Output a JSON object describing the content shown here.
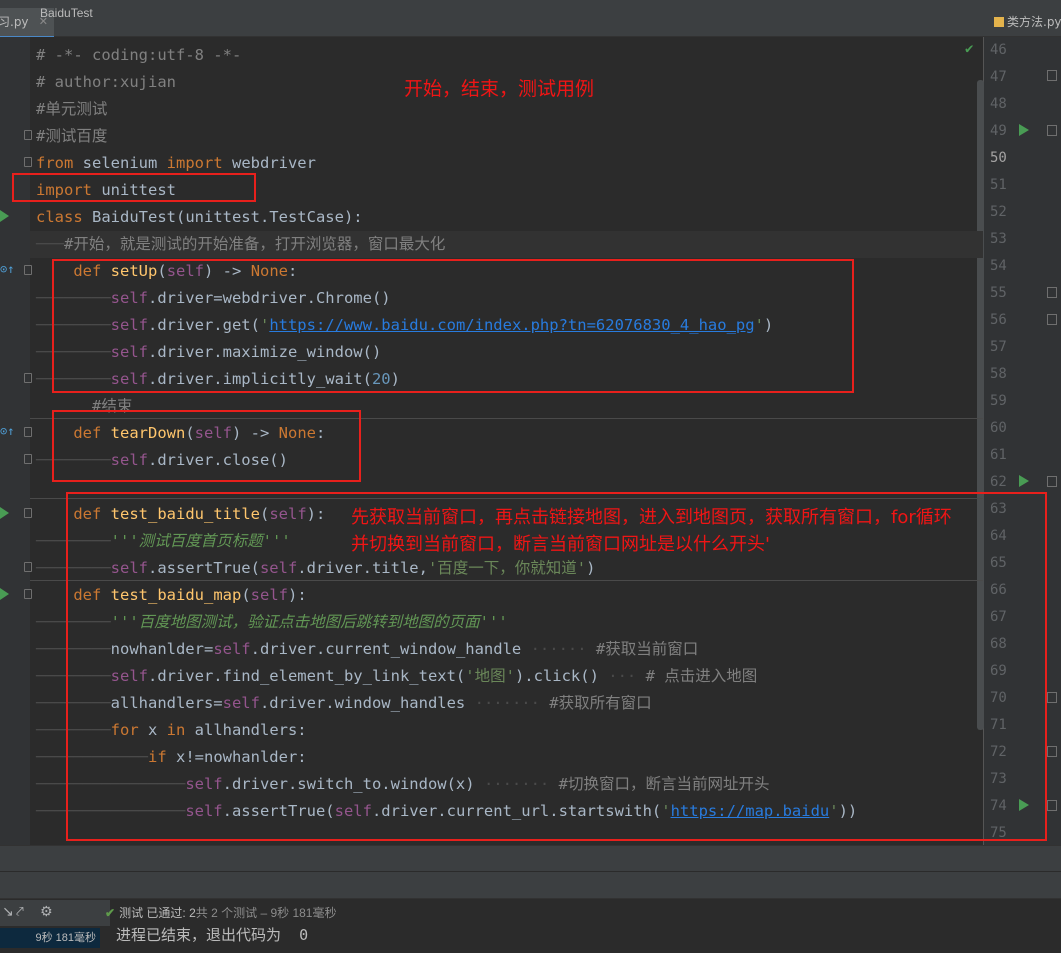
{
  "tabs": {
    "left": "练习.py",
    "right": "类方法.py"
  },
  "editor": {
    "lines": {
      "coding": "# -*- coding:utf-8 -*-",
      "author": "# author:xujian",
      "c_unit": "#单元测试",
      "c_baidu": "#测试百度",
      "from": "from",
      "selenium": " selenium ",
      "import_kw": "import",
      "webdriver": " webdriver",
      "import2_kw": "import",
      "unittest": " unittest",
      "class_kw": "class",
      "class_rest": " BaiduTest(unittest.TestCase):",
      "c_start": "#开始，就是测试的开始准备，打开浏览器，窗口最大化",
      "def": "def",
      "setup": "setUp",
      "self": "self",
      "arrow_none": ") -> ",
      "none": "None",
      "colon": ":",
      "open_paren": "(",
      "driver_chrome": ".driver=webdriver.Chrome()",
      "driver_get": ".driver.get(",
      "url1": "https://www.baidu.com/index.php?tn=62076830_4_hao_pg",
      "q": "'",
      "close_paren": ")",
      "maximize": ".driver.maximize_window()",
      "implicit": ".driver.implicitly_wait(",
      "twenty": "20",
      "c_end": "#结束",
      "teardown": "tearDown",
      "driver_close": ".driver.close()",
      "test_title": "test_baidu_title",
      "self_close": "):",
      "doc_title": "'''测试百度首页标题'''",
      "assert_title": ".assertTrue(",
      "driver_title": ".driver.title,",
      "str_baidu": "'百度一下，你就知道'",
      "test_map": "test_baidu_map",
      "doc_map": "'''百度地图测试，验证点击地图后跳转到地图的页面'''",
      "nowhandler": "nowhanlder=",
      "cur_handle": ".driver.current_window_handle",
      "c_get_cur": "#获取当前窗口",
      "find_link": ".driver.find_element_by_link_text(",
      "str_map": "'地图'",
      "click": ").click()",
      "c_click": "# 点击进入地图",
      "allhandlers": "allhandlers=",
      "win_handles": ".driver.window_handles",
      "c_all": "#获取所有窗口",
      "for_kw": "for",
      "x": " x ",
      "in_kw": "in",
      "allh": " allhandlers:",
      "if_kw": "if",
      "cond": " x!=nowhanlder:",
      "switch": ".driver.switch_to.window(x)",
      "c_switch": "#切换窗口，断言当前网址开头",
      "assert": ".assertTrue(",
      "cur_url": ".driver.current_url.startswith(",
      "url2": "https://map.baidu",
      "end_paren": "))"
    },
    "line_numbers": [
      "46",
      "47",
      "48",
      "49",
      "50",
      "51",
      "52",
      "53",
      "54",
      "55",
      "56",
      "57",
      "58",
      "59",
      "60",
      "61",
      "62",
      "63",
      "64",
      "65",
      "66",
      "67",
      "68",
      "69",
      "70",
      "71",
      "72",
      "73",
      "74",
      "75"
    ],
    "current_line": "50"
  },
  "annotations": {
    "note1": "开始，结束，测试用例",
    "note2_line1": "先获取当前窗口，再点击链接地图，进入到地图页，获取所有窗口，for循环",
    "note2_line2": "并切换到当前窗口，断言当前窗口网址是以什么开头'"
  },
  "breadcrumb": "BaiduTest",
  "run": {
    "status_prefix": "测试",
    "status_pass": "已通过: 2",
    "status_rest": "共 2 个测试 – 9秒 181毫秒",
    "time": "9秒 181毫秒",
    "output": "进程已结束，退出代码为  0"
  },
  "colors": {
    "accent_red": "#e8201c",
    "run_green": "#499c54"
  }
}
